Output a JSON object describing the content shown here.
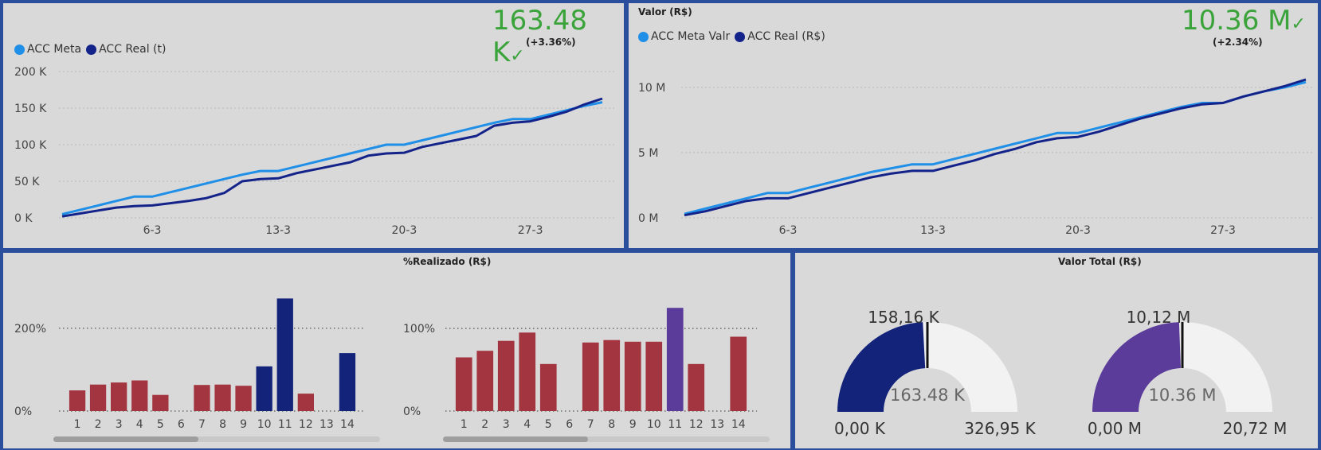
{
  "panels": {
    "top_left": {
      "kpi": "163.48 K",
      "kpi_delta": "(+3.36%)",
      "legend": [
        "ACC Meta",
        "ACC Real (t)"
      ]
    },
    "top_right": {
      "title": "Valor (R$)",
      "kpi": "10.36 M",
      "kpi_delta": "(+2.34%)",
      "legend": [
        "ACC Meta Valr",
        "ACC Real (R$)"
      ]
    },
    "bottom_left": {
      "title": "%Realizado (R$)"
    },
    "bottom_right": {
      "title": "Valor Total (R$)"
    }
  },
  "colors": {
    "meta": "#1f8fe8",
    "real": "#13238a",
    "bar_red": "#a33540",
    "bar_navy": "#13237a",
    "bar_purple": "#5b3c9a",
    "gauge_track": "#f2f2f2",
    "kpi_green": "#3aa33a"
  },
  "chart_data": [
    {
      "type": "line",
      "x": [
        "1-3",
        "2-3",
        "3-3",
        "4-3",
        "5-3",
        "6-3",
        "7-3",
        "8-3",
        "9-3",
        "10-3",
        "11-3",
        "12-3",
        "13-3",
        "14-3",
        "15-3",
        "16-3",
        "17-3",
        "18-3",
        "19-3",
        "20-3",
        "21-3",
        "22-3",
        "23-3",
        "24-3",
        "25-3",
        "26-3",
        "27-3",
        "28-3",
        "29-3",
        "30-3",
        "31-3"
      ],
      "series": [
        {
          "name": "ACC Meta",
          "values": [
            5,
            11,
            17,
            23,
            29,
            29,
            35,
            41,
            47,
            53,
            59,
            64,
            64,
            70,
            76,
            82,
            88,
            94,
            100,
            100,
            106,
            112,
            118,
            124,
            130,
            135,
            135,
            141,
            147,
            153,
            158
          ]
        },
        {
          "name": "ACC Real (t)",
          "values": [
            2,
            6,
            10,
            14,
            16,
            17,
            20,
            23,
            27,
            34,
            50,
            53,
            54,
            61,
            66,
            71,
            76,
            85,
            88,
            89,
            97,
            102,
            107,
            112,
            126,
            130,
            132,
            138,
            145,
            155,
            163
          ]
        }
      ],
      "xticks": [
        "6-3",
        "13-3",
        "20-3",
        "27-3"
      ],
      "yticks": [
        "0 K",
        "50 K",
        "100 K",
        "150 K",
        "200 K"
      ],
      "ylim": [
        0,
        200
      ]
    },
    {
      "type": "line",
      "x": [
        "1-3",
        "2-3",
        "3-3",
        "4-3",
        "5-3",
        "6-3",
        "7-3",
        "8-3",
        "9-3",
        "10-3",
        "11-3",
        "12-3",
        "13-3",
        "14-3",
        "15-3",
        "16-3",
        "17-3",
        "18-3",
        "19-3",
        "20-3",
        "21-3",
        "22-3",
        "23-3",
        "24-3",
        "25-3",
        "26-3",
        "27-3",
        "28-3",
        "29-3",
        "30-3",
        "31-3"
      ],
      "series": [
        {
          "name": "ACC Meta Valr",
          "values": [
            0.3,
            0.7,
            1.1,
            1.5,
            1.9,
            1.9,
            2.3,
            2.7,
            3.1,
            3.5,
            3.8,
            4.1,
            4.1,
            4.5,
            4.9,
            5.3,
            5.7,
            6.1,
            6.5,
            6.5,
            6.9,
            7.3,
            7.7,
            8.1,
            8.5,
            8.8,
            8.8,
            9.3,
            9.7,
            10.0,
            10.4
          ]
        },
        {
          "name": "ACC Real (R$)",
          "values": [
            0.2,
            0.5,
            0.9,
            1.3,
            1.5,
            1.5,
            1.9,
            2.3,
            2.7,
            3.1,
            3.4,
            3.6,
            3.6,
            4.0,
            4.4,
            4.9,
            5.3,
            5.8,
            6.1,
            6.2,
            6.6,
            7.1,
            7.6,
            8.0,
            8.4,
            8.7,
            8.8,
            9.3,
            9.7,
            10.1,
            10.6
          ]
        }
      ],
      "xticks": [
        "6-3",
        "13-3",
        "20-3",
        "27-3"
      ],
      "yticks": [
        "0 M",
        "5 M",
        "10 M"
      ],
      "ylim": [
        0,
        12
      ]
    },
    {
      "type": "bar",
      "categories": [
        "1",
        "2",
        "3",
        "4",
        "5",
        "6",
        "7",
        "8",
        "9",
        "10",
        "11",
        "12",
        "13",
        "14"
      ],
      "values": [
        50,
        64,
        69,
        74,
        39,
        0,
        63,
        64,
        61,
        108,
        272,
        42,
        0,
        140
      ],
      "colors": [
        "red",
        "red",
        "red",
        "red",
        "red",
        "red",
        "red",
        "red",
        "red",
        "navy",
        "navy",
        "red",
        "red",
        "navy"
      ],
      "yticks": [
        "0%",
        "200%"
      ],
      "ylim": [
        0,
        290
      ]
    },
    {
      "type": "bar",
      "title": "%Realizado (R$)",
      "categories": [
        "1",
        "2",
        "3",
        "4",
        "5",
        "6",
        "7",
        "8",
        "9",
        "10",
        "11",
        "12",
        "13",
        "14"
      ],
      "values": [
        65,
        73,
        85,
        95,
        57,
        0,
        83,
        86,
        84,
        84,
        125,
        57,
        0,
        90
      ],
      "colors": [
        "red",
        "red",
        "red",
        "red",
        "red",
        "red",
        "red",
        "red",
        "red",
        "red",
        "purple",
        "red",
        "red",
        "red"
      ],
      "yticks": [
        "0%",
        "100%"
      ],
      "ylim": [
        0,
        130
      ]
    },
    {
      "type": "gauge",
      "value": 158.16,
      "max": 326.95,
      "target": 163.48,
      "value_label": "158,16 K",
      "center_label": "163.48 K",
      "min_label": "0,00 K",
      "max_label": "326,95 K",
      "color": "navy"
    },
    {
      "type": "gauge",
      "title": "Valor Total (R$)",
      "value": 10.12,
      "max": 20.72,
      "target": 10.36,
      "value_label": "10,12 M",
      "center_label": "10.36 M",
      "min_label": "0,00 M",
      "max_label": "20,72 M",
      "color": "purple"
    }
  ]
}
